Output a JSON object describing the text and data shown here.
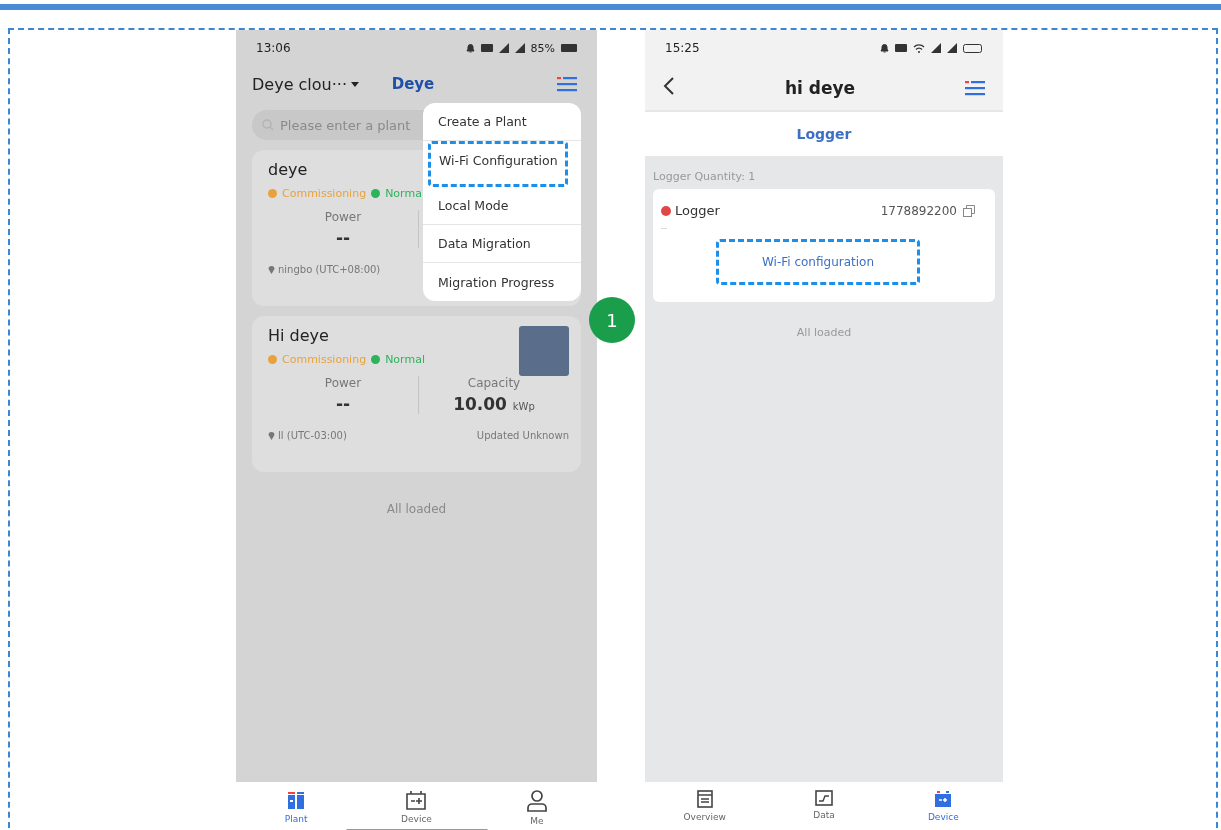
{
  "left_phone": {
    "status_bar": {
      "time": "13:06",
      "battery": "85%"
    },
    "header": {
      "account": "Deye clou···",
      "logo": "Deye"
    },
    "search": {
      "placeholder": "Please enter a plant"
    },
    "plants": [
      {
        "name": "deye",
        "statuses": [
          {
            "kind": "commissioning",
            "label": "Commissioning"
          },
          {
            "kind": "normal",
            "label": "Norma"
          }
        ],
        "power_label": "Power",
        "power_value": "--",
        "location": "ningbo  (UTC+08:00)",
        "photo": false
      },
      {
        "name": "Hi deye",
        "statuses": [
          {
            "kind": "commissioning",
            "label": "Commissioning"
          },
          {
            "kind": "normal",
            "label": "Normal"
          }
        ],
        "power_label": "Power",
        "power_value": "--",
        "capacity_label": "Capacity",
        "capacity_value": "10.00",
        "capacity_unit": "kWp",
        "location": "ll (UTC-03:00)",
        "updated": "Updated  Unknown",
        "photo": true
      }
    ],
    "footer": "All loaded",
    "menu": {
      "items": [
        {
          "label": "Create a Plant",
          "highlighted": false
        },
        {
          "label": "Wi-Fi Configuration",
          "highlighted": true
        },
        {
          "label": "Local Mode",
          "highlighted": false
        },
        {
          "label": "Data Migration",
          "highlighted": false
        },
        {
          "label": "Migration Progress",
          "highlighted": false
        }
      ]
    },
    "tabs": [
      {
        "kind": "plant",
        "label": "Plant",
        "selected": true
      },
      {
        "kind": "device",
        "label": "Device",
        "selected": false
      },
      {
        "kind": "me",
        "label": "Me",
        "selected": false
      }
    ]
  },
  "step_badge": "1",
  "right_phone": {
    "status_bar": {
      "time": "15:25"
    },
    "header": {
      "title": "hi deye"
    },
    "section_tab": "Logger",
    "quantity": "Logger Quantity: 1",
    "logger": {
      "name": "Logger",
      "serial": "1778892200",
      "detail": "--",
      "action": "Wi-Fi configuration",
      "action_highlighted": true
    },
    "footer": "All loaded",
    "tabs": [
      {
        "kind": "overview",
        "label": "Overview",
        "selected": false
      },
      {
        "kind": "data",
        "label": "Data",
        "selected": false
      },
      {
        "kind": "device",
        "label": "Device",
        "selected": true
      }
    ]
  }
}
